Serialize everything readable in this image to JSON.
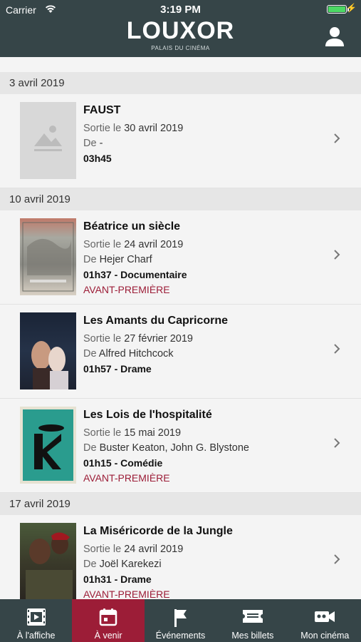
{
  "status": {
    "carrier": "Carrier",
    "time": "3:19 PM"
  },
  "header": {
    "logo": "LOUXOR",
    "tagline": "PALAIS DU CINÉMA",
    "profile_icon": "user-icon"
  },
  "sections": [
    {
      "date": "3 avril 2019",
      "movies": [
        {
          "title": "FAUST",
          "release_label": "Sortie le",
          "release_date": "30 avril 2019",
          "director_label": "De",
          "director": "-",
          "meta": "03h45",
          "avant": ""
        }
      ]
    },
    {
      "date": "10 avril 2019",
      "movies": [
        {
          "title": "Béatrice un siècle",
          "release_label": "Sortie le",
          "release_date": "24 avril 2019",
          "director_label": "De",
          "director": "Hejer Charf",
          "meta": "01h37 - Documentaire",
          "avant": "AVANT-PREMIÈRE"
        },
        {
          "title": "Les Amants du Capricorne",
          "release_label": "Sortie le",
          "release_date": "27 février 2019",
          "director_label": "De",
          "director": "Alfred Hitchcock",
          "meta": "01h57 - Drame",
          "avant": ""
        },
        {
          "title": "Les Lois de l'hospitalité",
          "release_label": "Sortie le",
          "release_date": "15 mai 2019",
          "director_label": "De",
          "director": "Buster Keaton,  John G. Blystone",
          "meta": "01h15 - Comédie",
          "avant": "AVANT-PREMIÈRE"
        }
      ]
    },
    {
      "date": "17 avril 2019",
      "movies": [
        {
          "title": "La Miséricorde de la Jungle",
          "release_label": "Sortie le",
          "release_date": "24 avril 2019",
          "director_label": "De",
          "director": "Joël Karekezi",
          "meta": "01h31 - Drame",
          "avant": "AVANT-PREMIÈRE"
        }
      ]
    }
  ],
  "tabs": [
    {
      "label": "À l'affiche",
      "icon": "film-icon",
      "active": false
    },
    {
      "label": "À venir",
      "icon": "calendar-icon",
      "active": true
    },
    {
      "label": "Événements",
      "icon": "flag-icon",
      "active": false
    },
    {
      "label": "Mes billets",
      "icon": "ticket-icon",
      "active": false
    },
    {
      "label": "Mon cinéma",
      "icon": "camera-icon",
      "active": false
    }
  ],
  "colors": {
    "header_bg": "#364548",
    "accent": "#9c1d37",
    "battery": "#4cd964"
  }
}
